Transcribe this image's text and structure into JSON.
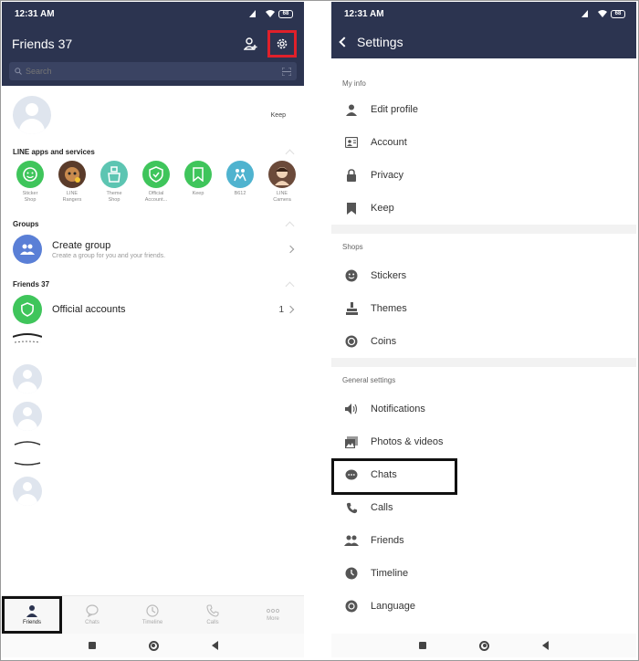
{
  "left": {
    "status_time": "12:31 AM",
    "battery": "68",
    "title": "Friends 37",
    "search_placeholder": "Search",
    "keep_label": "Keep",
    "apps_section": "LINE apps and services",
    "apps": [
      {
        "label": "Sticker\nShop",
        "color": "#3fc55b"
      },
      {
        "label": "LINE\nRangers",
        "color": "#5a3b2a"
      },
      {
        "label": "Theme\nShop",
        "color": "#5dc5b2"
      },
      {
        "label": "Official\nAccount...",
        "color": "#3fc55b"
      },
      {
        "label": "Keep",
        "color": "#3fc55b"
      },
      {
        "label": "B612",
        "color": "#4fb3cf"
      },
      {
        "label": "LINE\nCamera",
        "color": "#6b4a3a"
      }
    ],
    "groups_section": "Groups",
    "create_group": "Create group",
    "create_group_sub": "Create a group for you and your friends.",
    "friends_section": "Friends 37",
    "official_accounts": "Official accounts",
    "official_count": "1",
    "nav": [
      {
        "label": "Friends",
        "icon": "person-icon"
      },
      {
        "label": "Chats",
        "icon": "chat-bubble-icon"
      },
      {
        "label": "Timeline",
        "icon": "clock-icon"
      },
      {
        "label": "Calls",
        "icon": "phone-icon"
      },
      {
        "label": "More",
        "icon": "more-dots-icon"
      }
    ]
  },
  "right": {
    "status_time": "12:31 AM",
    "battery": "68",
    "title": "Settings",
    "sections": [
      {
        "title": "My info",
        "items": [
          "Edit profile",
          "Account",
          "Privacy",
          "Keep"
        ]
      },
      {
        "title": "Shops",
        "items": [
          "Stickers",
          "Themes",
          "Coins"
        ]
      },
      {
        "title": "General settings",
        "items": [
          "Notifications",
          "Photos & videos",
          "Chats",
          "Calls",
          "Friends",
          "Timeline",
          "Language"
        ]
      }
    ]
  },
  "colors": {
    "header_bg": "#2c3450",
    "highlight_red": "#e0202a",
    "line_green": "#3fc55b"
  }
}
